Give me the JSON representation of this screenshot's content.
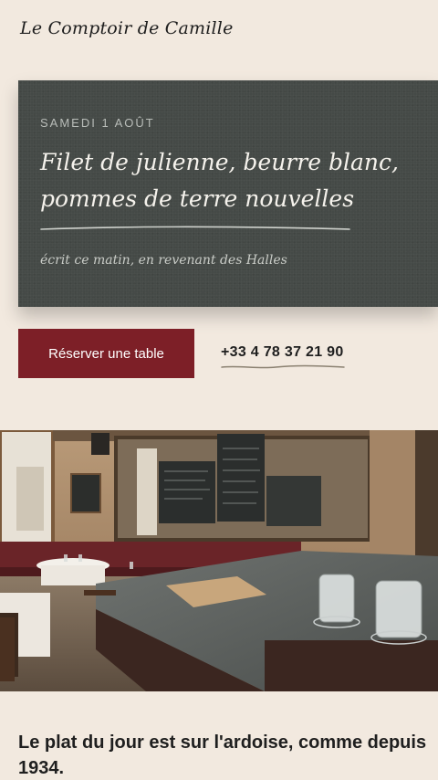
{
  "header": {
    "brand": "Le Comptoir de Camille"
  },
  "board": {
    "date": "SAMEDI 1 AOÛT",
    "dish": "Filet de julienne, beurre blanc, pommes de terre nouvelles",
    "note": "écrit ce matin, en revenant des Halles"
  },
  "actions": {
    "reserve_label": "Réserver une table",
    "phone": "+33 4 78 37 21 90"
  },
  "photo": {
    "description_icon": "restaurant-interior-photo"
  },
  "tagline": "Le plat du jour est sur l'ardoise, comme depuis 1934.",
  "colors": {
    "background": "#f2e9df",
    "slate": "#454a47",
    "accent": "#7d1f27"
  }
}
